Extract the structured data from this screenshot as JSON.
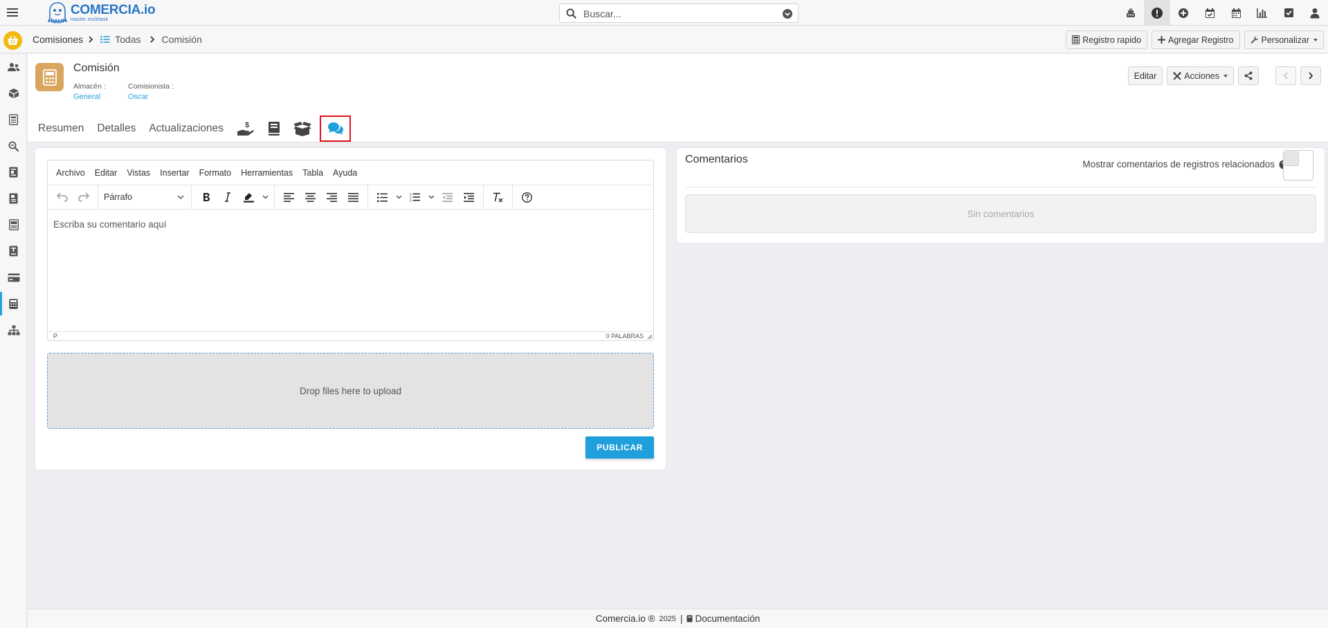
{
  "app": {
    "logo_name": "COMERCIA.io",
    "logo_tagline": "master multitask"
  },
  "search": {
    "placeholder": "Buscar..."
  },
  "topbar_icons": [
    "cash-register-icon",
    "exclamation-circle-icon",
    "plus-circle-icon",
    "calendar-check-icon",
    "calendar-icon",
    "chart-bar-icon",
    "check-square-icon",
    "user-icon"
  ],
  "breadcrumb": {
    "root": "Comisiones",
    "list": "Todas",
    "current": "Comisión"
  },
  "toolbar2": {
    "quick_record": "Registro rapido",
    "add_record": "Agregar Registro",
    "customize": "Personalizar"
  },
  "record": {
    "title": "Comisión",
    "fields": [
      {
        "label": "Almacén :",
        "value": "General"
      },
      {
        "label": "Comisionista :",
        "value": "Oscar"
      }
    ],
    "edit": "Editar",
    "actions": "Acciones"
  },
  "tabs": [
    "Resumen",
    "Detalles",
    "Actualizaciones"
  ],
  "tab_icons": [
    "hand-dollar-icon",
    "book-icon",
    "box-open-icon",
    "comments-icon"
  ],
  "editor": {
    "menu": [
      "Archivo",
      "Editar",
      "Vistas",
      "Insertar",
      "Formato",
      "Herramientas",
      "Tabla",
      "Ayuda"
    ],
    "block_format": "Párrafo",
    "placeholder": "Escriba su comentario aquí",
    "status_path": "P",
    "word_count": "0 PALABRAS"
  },
  "upload": {
    "label": "Drop files here to upload"
  },
  "publish_label": "PUBLICAR",
  "comments": {
    "title": "Comentarios",
    "related_label": "Mostrar comentarios de registros relacionados",
    "related_enabled": false,
    "empty": "Sin comentarios"
  },
  "footer": {
    "brand": "Comercia.io ®",
    "year": "2025",
    "separator": "|",
    "docs": "Documentación"
  },
  "colors": {
    "accent": "#1f9fdc",
    "logo": "#2a76c9",
    "record_icon_bg": "#d9a55f",
    "basket": "#f0b90b",
    "highlight_box": "#e0101e"
  }
}
